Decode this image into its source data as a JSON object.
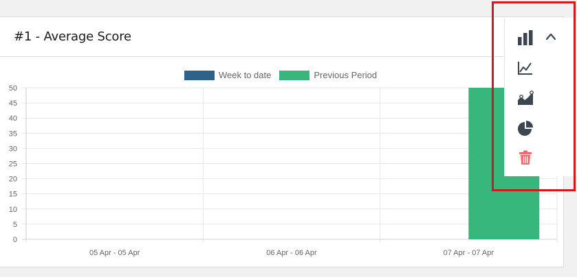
{
  "card": {
    "title": "#1 - Average Score"
  },
  "legend": [
    {
      "label": "Week to date",
      "color": "#2e6289"
    },
    {
      "label": "Previous Period",
      "color": "#37b77b"
    }
  ],
  "toolbar": {
    "tools": [
      {
        "name": "bar-chart-icon",
        "color": "#3d4650"
      },
      {
        "name": "chevron-up-icon",
        "color": "#3d4650"
      },
      {
        "name": "line-chart-icon",
        "color": "#3d4650"
      },
      {
        "name": "area-chart-icon",
        "color": "#3d4650"
      },
      {
        "name": "pie-chart-icon",
        "color": "#3d4650"
      },
      {
        "name": "trash-icon",
        "color": "#f46a6a"
      }
    ]
  },
  "chart_data": {
    "type": "bar",
    "categories": [
      "05 Apr - 05 Apr",
      "06 Apr - 06 Apr",
      "07 Apr - 07 Apr"
    ],
    "series": [
      {
        "name": "Week to date",
        "values": [
          0,
          0,
          0
        ],
        "color": "#2e6289"
      },
      {
        "name": "Previous Period",
        "values": [
          0,
          0,
          50
        ],
        "color": "#37b77b"
      }
    ],
    "ylim": [
      0,
      50
    ],
    "yticks": [
      "50",
      "45",
      "40",
      "35",
      "30",
      "25",
      "20",
      "15",
      "10",
      "5",
      "0"
    ],
    "grid": true,
    "legend_position": "top"
  }
}
